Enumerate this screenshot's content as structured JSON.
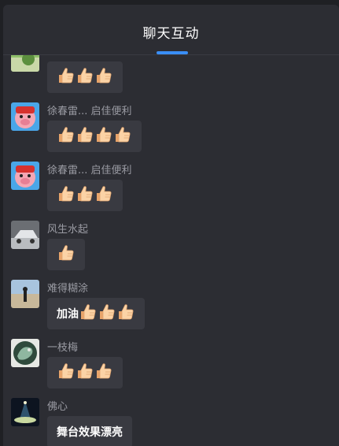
{
  "header": {
    "title": "聊天互动"
  },
  "messages": [
    {
      "avatar": "green-avatar",
      "nickname": "",
      "text": "",
      "thumbs": 3
    },
    {
      "avatar": "pig-avatar",
      "nickname": "徐春雷... 启佳便利",
      "text": "",
      "thumbs": 4
    },
    {
      "avatar": "pig-avatar",
      "nickname": "徐春雷... 启佳便利",
      "text": "",
      "thumbs": 3
    },
    {
      "avatar": "car-avatar",
      "nickname": "风生水起",
      "text": "",
      "thumbs": 1
    },
    {
      "avatar": "beach-avatar",
      "nickname": "难得糊涂",
      "text": "加油",
      "thumbs": 3
    },
    {
      "avatar": "dragon-avatar",
      "nickname": "一枝梅",
      "text": "",
      "thumbs": 3
    },
    {
      "avatar": "stage-avatar",
      "nickname": "佛心",
      "text": "舞台效果漂亮",
      "thumbs": 0
    }
  ],
  "icons": {
    "thumb": "thumbs-up-icon"
  },
  "colors": {
    "accent": "#3a8ef6",
    "panel": "#2c2d33",
    "bubble": "#393a41",
    "nickname": "#9a9ba3"
  }
}
